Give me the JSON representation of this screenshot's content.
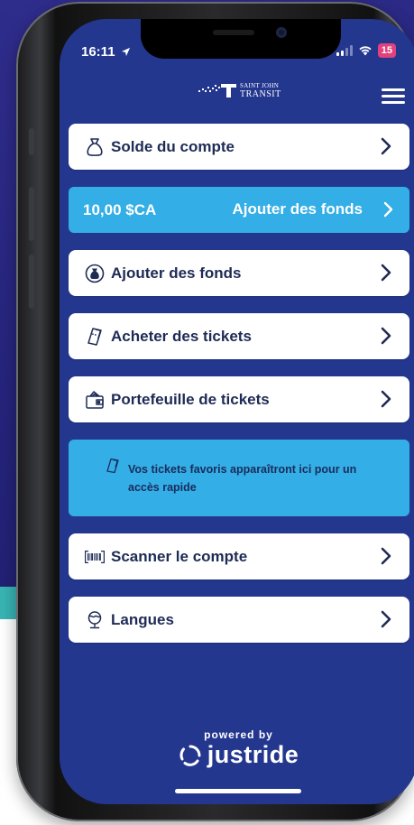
{
  "status_bar": {
    "time": "16:11",
    "battery": "15"
  },
  "header": {
    "logo_line1": "SAINT JOHN",
    "logo_line2": "TRANSIT",
    "menu_icon": "hamburger-menu-icon"
  },
  "menu": {
    "account_balance": {
      "label": "Solde du compte",
      "icon": "money-bag-icon"
    },
    "balance_bar": {
      "amount": "10,00 $CA",
      "action": "Ajouter des fonds"
    },
    "add_funds": {
      "label": "Ajouter des fonds",
      "icon": "add-money-icon"
    },
    "buy_tickets": {
      "label": "Acheter des tickets",
      "icon": "ticket-icon"
    },
    "ticket_wallet": {
      "label": "Portefeuille de tickets",
      "icon": "wallet-icon"
    },
    "favorites_message": "Vos tickets favoris apparaîtront ici pour un accès rapide",
    "scan_account": {
      "label": "Scanner le compte",
      "icon": "barcode-icon"
    },
    "languages": {
      "label": "Langues",
      "icon": "language-icon"
    }
  },
  "footer": {
    "powered_by": "powered by",
    "brand": "justride"
  },
  "colors": {
    "screen_background": "#24378f",
    "accent_blue": "#33aee6",
    "card_text": "#1e2b55",
    "battery_badge": "#e1417c"
  }
}
